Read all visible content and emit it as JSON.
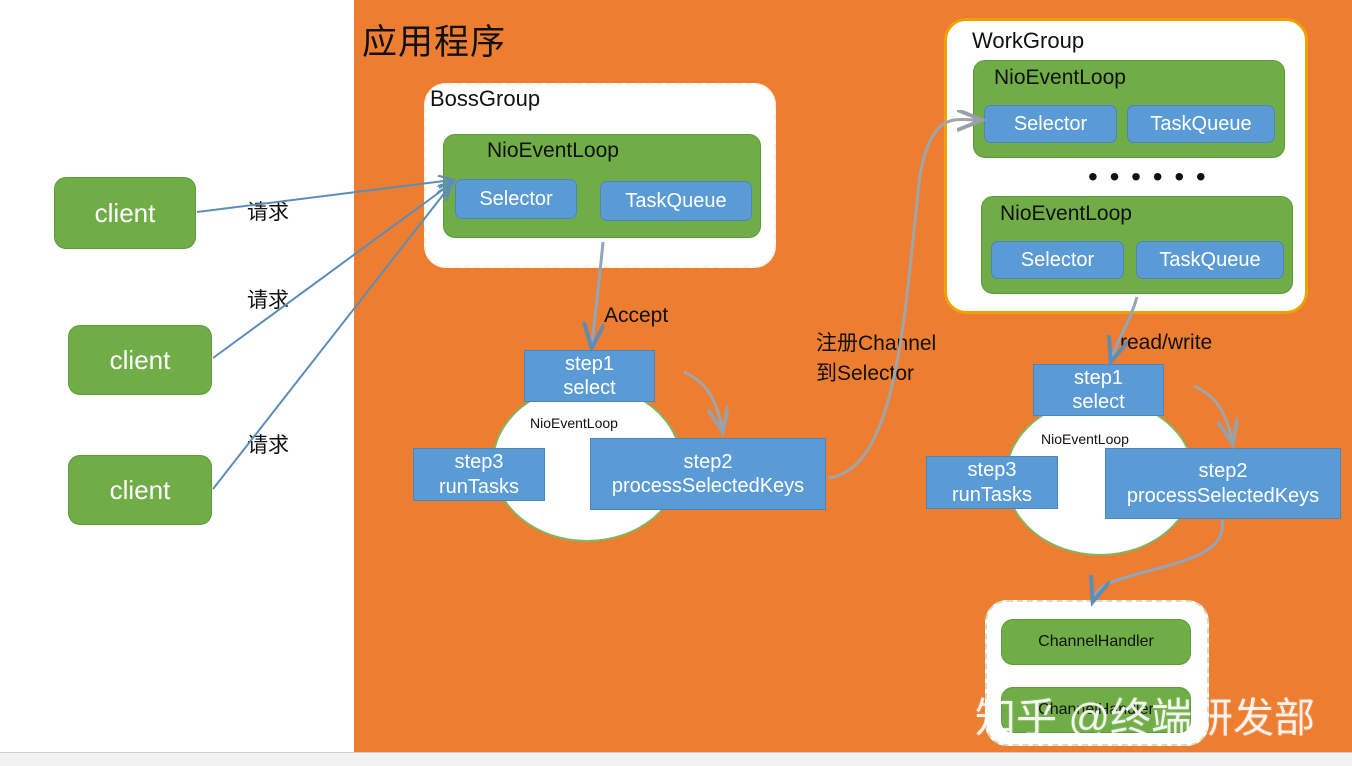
{
  "colors": {
    "background_orange": "#ED7D31",
    "green": "#70AD47",
    "blue": "#5B9BD5",
    "workgroup_border": "#F0A000",
    "arrow_blue": "#5B8DB8",
    "arrow_gray": "#A0A5AA",
    "text_dark": "#111111"
  },
  "app": {
    "title": "应用程序"
  },
  "clients": [
    {
      "label": "client"
    },
    {
      "label": "client"
    },
    {
      "label": "client"
    }
  ],
  "request_labels": [
    {
      "text": "请求"
    },
    {
      "text": "请求"
    },
    {
      "text": "请求"
    }
  ],
  "boss_group": {
    "title": "BossGroup",
    "event_loop": {
      "title": "NioEventLoop",
      "selector": "Selector",
      "task_queue": "TaskQueue"
    }
  },
  "work_group": {
    "title": "WorkGroup",
    "ellipsis": "• • • • • •",
    "event_loops": [
      {
        "title": "NioEventLoop",
        "selector": "Selector",
        "task_queue": "TaskQueue"
      },
      {
        "title": "NioEventLoop",
        "selector": "Selector",
        "task_queue": "TaskQueue"
      }
    ]
  },
  "edge_labels": {
    "accept": "Accept",
    "register_line1": "注册Channel",
    "register_line2": "到Selector",
    "read_write": "read/write"
  },
  "boss_cycle": {
    "center_label": "NioEventLoop",
    "steps": [
      {
        "line1": "step1",
        "line2": "select"
      },
      {
        "line1": "step2",
        "line2": "processSelectedKeys"
      },
      {
        "line1": "step3",
        "line2": "runTasks"
      }
    ]
  },
  "work_cycle": {
    "center_label": "NioEventLoop",
    "steps": [
      {
        "line1": "step1",
        "line2": "select"
      },
      {
        "line1": "step2",
        "line2": "processSelectedKeys"
      },
      {
        "line1": "step3",
        "line2": "runTasks"
      }
    ]
  },
  "handlers": {
    "items": [
      {
        "label": "ChannelHandler"
      },
      {
        "label": "ChannelHandler"
      }
    ]
  },
  "watermark": {
    "text": "知乎 @终端研发部"
  }
}
